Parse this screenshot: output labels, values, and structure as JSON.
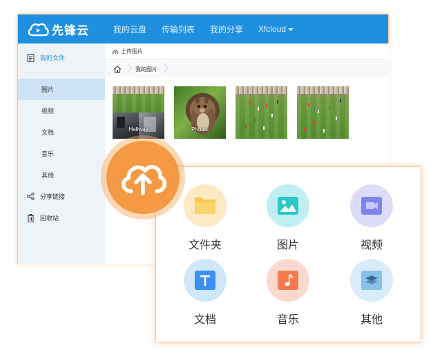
{
  "app": {
    "logo_text": "先锋云",
    "nav": [
      "我的云盘",
      "传输列表",
      "我的分享",
      "Xfcloud"
    ]
  },
  "sidebar": {
    "my_files": "我的文件",
    "items": [
      "图片",
      "视频",
      "文档",
      "音乐",
      "其他"
    ],
    "share_links": "分享链接",
    "recycle_bin": "回收站"
  },
  "content": {
    "upload_button": "上传图片",
    "breadcrumb": "我的图片",
    "thumbnails": [
      {
        "label": "Hallway"
      },
      {
        "label": "Photos"
      },
      {
        "label": ""
      },
      {
        "label": ""
      }
    ]
  },
  "upload_panel": {
    "categories": [
      {
        "label": "文件夹",
        "icon": "folder-icon",
        "bg": "#fde9c4",
        "color": "#fbc64f"
      },
      {
        "label": "图片",
        "icon": "image-icon",
        "bg": "#bfeff2",
        "color": "#2cc7c8"
      },
      {
        "label": "视频",
        "icon": "video-icon",
        "bg": "#dcdcf8",
        "color": "#7e86ee"
      },
      {
        "label": "文档",
        "icon": "text-doc-icon",
        "bg": "#cfe7fb",
        "color": "#3d8ff0"
      },
      {
        "label": "音乐",
        "icon": "music-icon",
        "bg": "#fcd9cf",
        "color": "#f57a4e"
      },
      {
        "label": "其他",
        "icon": "layers-icon",
        "bg": "#d8ecf9",
        "color": "#86c3ea"
      }
    ]
  },
  "colors": {
    "brand": "#1f8fe0",
    "upload_accent": "#f59a44"
  }
}
